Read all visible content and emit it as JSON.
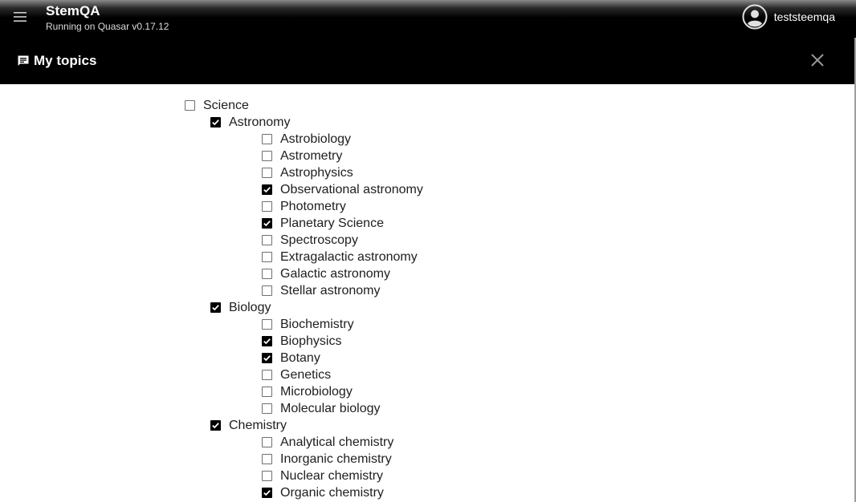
{
  "header": {
    "title": "StemQA",
    "subtitle": "Running on Quasar v0.17.12",
    "username": "teststeemqa"
  },
  "dialog": {
    "title": "My topics"
  },
  "topics": [
    {
      "label": "Science",
      "level": 0,
      "checked": false
    },
    {
      "label": "Astronomy",
      "level": 1,
      "checked": true
    },
    {
      "label": "Astrobiology",
      "level": 2,
      "checked": false
    },
    {
      "label": "Astrometry",
      "level": 2,
      "checked": false
    },
    {
      "label": "Astrophysics",
      "level": 2,
      "checked": false
    },
    {
      "label": "Observational astronomy",
      "level": 2,
      "checked": true
    },
    {
      "label": "Photometry",
      "level": 2,
      "checked": false
    },
    {
      "label": "Planetary Science",
      "level": 2,
      "checked": true
    },
    {
      "label": "Spectroscopy",
      "level": 2,
      "checked": false
    },
    {
      "label": "Extragalactic astronomy",
      "level": 2,
      "checked": false
    },
    {
      "label": "Galactic astronomy",
      "level": 2,
      "checked": false
    },
    {
      "label": "Stellar astronomy",
      "level": 2,
      "checked": false
    },
    {
      "label": "Biology",
      "level": 1,
      "checked": true
    },
    {
      "label": "Biochemistry",
      "level": 2,
      "checked": false
    },
    {
      "label": "Biophysics",
      "level": 2,
      "checked": true
    },
    {
      "label": "Botany",
      "level": 2,
      "checked": true
    },
    {
      "label": "Genetics",
      "level": 2,
      "checked": false
    },
    {
      "label": "Microbiology",
      "level": 2,
      "checked": false
    },
    {
      "label": "Molecular biology",
      "level": 2,
      "checked": false
    },
    {
      "label": "Chemistry",
      "level": 1,
      "checked": true
    },
    {
      "label": "Analytical chemistry",
      "level": 2,
      "checked": false
    },
    {
      "label": "Inorganic chemistry",
      "level": 2,
      "checked": false
    },
    {
      "label": "Nuclear chemistry",
      "level": 2,
      "checked": false
    },
    {
      "label": "Organic chemistry",
      "level": 2,
      "checked": true
    }
  ],
  "icons": {
    "menu": "menu-icon",
    "avatar": "account-circle-icon",
    "topics": "forum-icon",
    "close": "close-icon"
  },
  "colors": {
    "header_bg": "#000000",
    "checkbox_checked": "#000000",
    "checkbox_border": "#6f6f6f"
  }
}
